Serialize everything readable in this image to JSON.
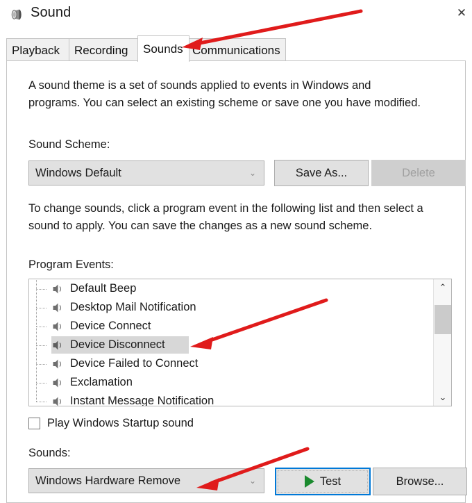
{
  "window": {
    "title": "Sound",
    "icon": "speaker-icon",
    "close_label": "✕"
  },
  "tabs": [
    {
      "label": "Playback",
      "active": false
    },
    {
      "label": "Recording",
      "active": false
    },
    {
      "label": "Sounds",
      "active": true
    },
    {
      "label": "Communications",
      "active": false
    }
  ],
  "body": {
    "intro_paragraph": "A sound theme is a set of sounds applied to events in Windows and programs.  You can select an existing scheme or save one you have modified.",
    "change_paragraph": "To change sounds, click a program event in the following list and then select a sound to apply.  You can save the changes as a new sound scheme.",
    "scheme_label": "Sound Scheme:",
    "scheme_value": "Windows Default",
    "save_as_label": "Save As...",
    "delete_label": "Delete",
    "events_label": "Program Events:",
    "events": [
      {
        "label": "Default Beep",
        "selected": false
      },
      {
        "label": "Desktop Mail Notification",
        "selected": false
      },
      {
        "label": "Device Connect",
        "selected": false
      },
      {
        "label": "Device Disconnect",
        "selected": true
      },
      {
        "label": "Device Failed to Connect",
        "selected": false
      },
      {
        "label": "Exclamation",
        "selected": false
      },
      {
        "label": "Instant Message Notification",
        "selected": false
      }
    ],
    "scroll_up_glyph": "⌃",
    "scroll_down_glyph": "⌄",
    "startup_checkbox_label": "Play Windows Startup sound",
    "startup_checkbox_checked": false,
    "sounds_label": "Sounds:",
    "sounds_value": "Windows Hardware Remove",
    "test_label": "Test",
    "browse_label": "Browse...",
    "chevron_glyph": "⌄"
  },
  "colors": {
    "accent_focus": "#0078d7",
    "play_triangle": "#1a8a2e",
    "annotation_arrow": "#e01b1b",
    "selection_highlight": "#d7d7d7",
    "control_face": "#e1e1e1",
    "disabled_face": "#cfcfcf"
  },
  "annotations": [
    {
      "name": "arrow-to-sounds-tab",
      "target": "Sounds tab"
    },
    {
      "name": "arrow-to-device-disconnect",
      "target": "Device Disconnect list item"
    },
    {
      "name": "arrow-to-sounds-combo",
      "target": "Sounds combo box"
    }
  ]
}
